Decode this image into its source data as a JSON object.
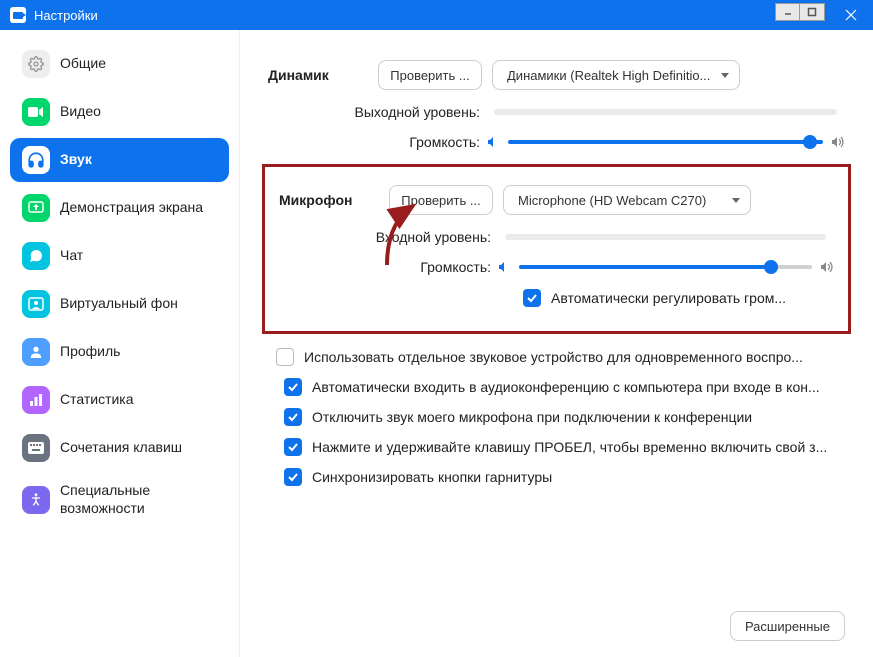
{
  "titlebar": {
    "title": "Настройки"
  },
  "sidebar": {
    "items": [
      {
        "label": "Общие"
      },
      {
        "label": "Видео"
      },
      {
        "label": "Звук"
      },
      {
        "label": "Демонстрация экрана"
      },
      {
        "label": "Чат"
      },
      {
        "label": "Виртуальный фон"
      },
      {
        "label": "Профиль"
      },
      {
        "label": "Статистика"
      },
      {
        "label": "Сочетания клавиш"
      },
      {
        "label": "Специальные возможности"
      }
    ]
  },
  "speaker": {
    "title": "Динамик",
    "test": "Проверить ...",
    "device": "Динамики (Realtek High Definitio...",
    "output_label": "Выходной уровень:",
    "volume_label": "Громкость:",
    "volume_pct": 96
  },
  "mic": {
    "title": "Микрофон",
    "test": "Проверить ...",
    "device": "Microphone (HD Webcam C270)",
    "input_label": "Входной уровень:",
    "volume_label": "Громкость:",
    "volume_pct": 86,
    "auto_adjust": "Автоматически регулировать гром..."
  },
  "options": {
    "separate_device": "Использовать отдельное звуковое устройство для одновременного воспро...",
    "auto_join": "Автоматически входить в аудиоконференцию с компьютера при входе в кон...",
    "mute_on_join": "Отключить звук моего микрофона при подключении к конференции",
    "push_to_talk": "Нажмите и удерживайте клавишу ПРОБЕЛ, чтобы временно включить свой з...",
    "sync_headset": "Синхронизировать кнопки гарнитуры"
  },
  "advanced": "Расширенные"
}
